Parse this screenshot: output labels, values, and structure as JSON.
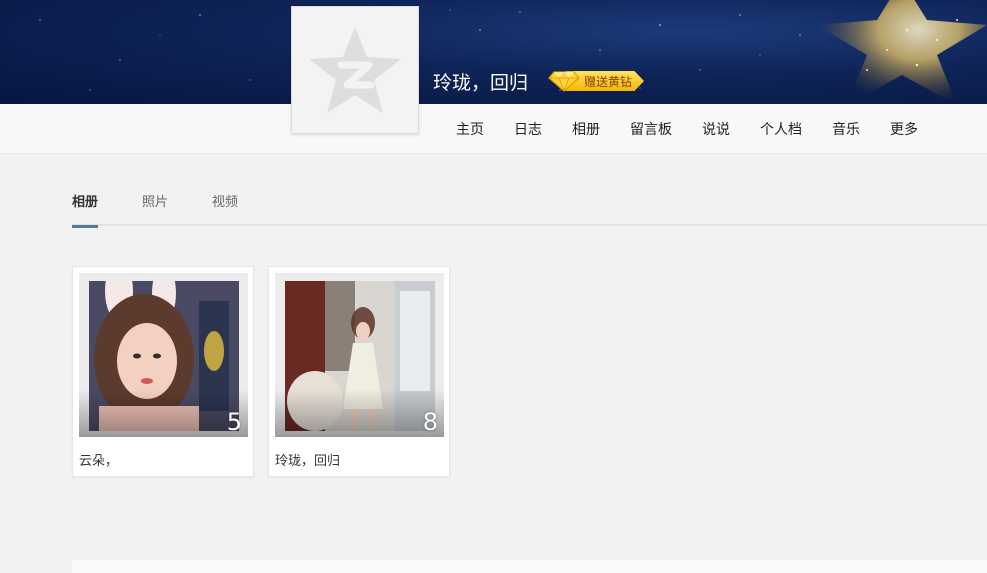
{
  "profile": {
    "name": "玲珑，回归",
    "badge_label": "赠送黄钻"
  },
  "nav": {
    "items": [
      {
        "label": "主页"
      },
      {
        "label": "日志"
      },
      {
        "label": "相册"
      },
      {
        "label": "留言板"
      },
      {
        "label": "说说"
      },
      {
        "label": "个人档"
      },
      {
        "label": "音乐"
      },
      {
        "label": "更多"
      }
    ]
  },
  "tabs": [
    {
      "label": "相册",
      "active": true
    },
    {
      "label": "照片",
      "active": false
    },
    {
      "label": "视频",
      "active": false
    }
  ],
  "albums": [
    {
      "title": "云朵，",
      "count": "5"
    },
    {
      "title": "玲珑，回归",
      "count": "8"
    }
  ],
  "colors": {
    "banner": "#0e2356",
    "tab_indicator": "#56789a",
    "badge": "#f5b800"
  },
  "icons": {
    "avatar_placeholder": "qzone-star-icon",
    "badge_icon": "diamond-icon"
  }
}
